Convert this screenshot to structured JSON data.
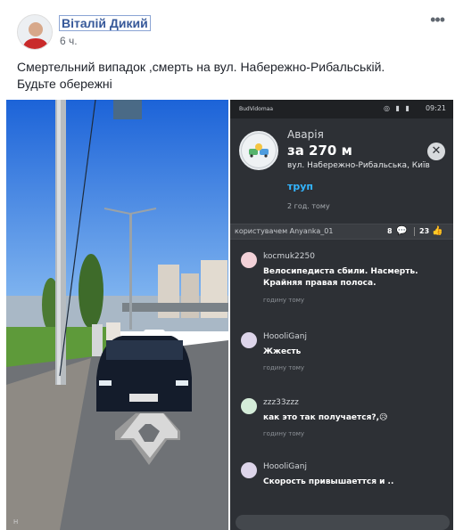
{
  "post": {
    "author": "Віталій Дикий",
    "time": "6 ч.",
    "text_line1": "Смертельний випадок ,смерть на вул. Набережно-Рибальській.",
    "text_line2": "Будьте обережні"
  },
  "colors": {
    "author_link": "#365899",
    "app_dark": "#2d3035",
    "accent_blue": "#33b5ff"
  },
  "app_screenshot": {
    "status": {
      "carrier": "BudVidomaa",
      "clock": "09:21"
    },
    "alert": {
      "title": "Аварія",
      "distance": "за 270 м",
      "address": "вул. Набережно-Рибальська, Київ",
      "type": "труп",
      "ago": "2 год. тому",
      "close_icon": "✕"
    },
    "reporter": {
      "by": "користувачем Anyanka_01",
      "likes": "8",
      "comments": "23"
    },
    "comments": [
      {
        "user": "kocmuk2250",
        "text": "Велосипедиста сбили. Насмерть. Крайняя правая полоса.",
        "ago": "годину тому"
      },
      {
        "user": "HoooliGanj",
        "text": "Жжесть",
        "ago": "годину тому"
      },
      {
        "user": "zzz33zzz",
        "text": "как это так получается?,😥",
        "ago": "годину тому"
      },
      {
        "user": "HoooliGanj",
        "text": "Скорость привышаеттся и ..",
        "ago": ""
      }
    ]
  }
}
